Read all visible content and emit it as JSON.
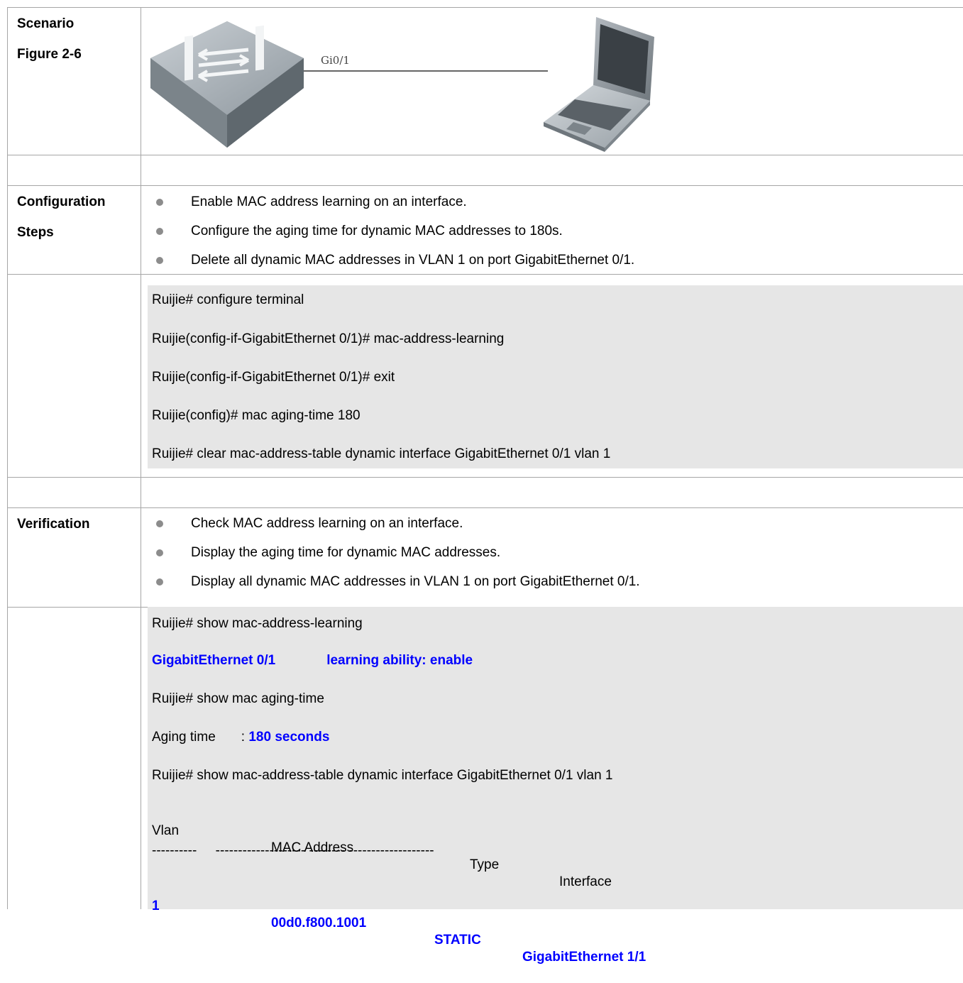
{
  "scenario": {
    "label_line1": "Scenario",
    "label_line2": "Figure 2-6",
    "figure": {
      "port_label": "Gi0/1",
      "switch": "switch-icon",
      "host": "laptop-icon"
    }
  },
  "configuration": {
    "label_line1": "Configuration",
    "label_line2": "Steps",
    "steps": [
      "Enable MAC address learning on an interface.",
      "Configure the aging time for dynamic MAC addresses to 180s.",
      "Delete all dynamic MAC addresses in VLAN 1 on port GigabitEthernet 0/1."
    ],
    "commands": [
      "Ruijie# configure terminal",
      "Ruijie(config-if-GigabitEthernet 0/1)# mac-address-learning",
      "Ruijie(config-if-GigabitEthernet 0/1)# exit",
      "Ruijie(config)# mac aging-time 180",
      "Ruijie# clear mac-address-table dynamic interface GigabitEthernet 0/1 vlan 1"
    ]
  },
  "verification": {
    "label": "Verification",
    "steps": [
      "Check MAC address learning on an interface.",
      "Display the aging time for dynamic MAC addresses.",
      "Display all dynamic MAC addresses in VLAN 1 on port GigabitEthernet 0/1."
    ],
    "output": {
      "cmd1": "Ruijie# show mac-address-learning",
      "learning_if": "GigabitEthernet 0/1",
      "learning_status": "learning ability: enable",
      "cmd2": "Ruijie# show mac aging-time",
      "aging_label": "Aging time",
      "aging_colon": ":",
      "aging_value": "180 seconds",
      "cmd3": "Ruijie# show mac-address-table dynamic interface GigabitEthernet 0/1 vlan 1",
      "table_headers": [
        "Vlan",
        "MAC Address",
        "Type",
        "Interface"
      ],
      "table_separator": "----------     -------------------- -------- -------------------",
      "table_row": [
        "1",
        "00d0.f800.1001",
        "STATIC",
        "GigabitEthernet 1/1"
      ]
    }
  }
}
